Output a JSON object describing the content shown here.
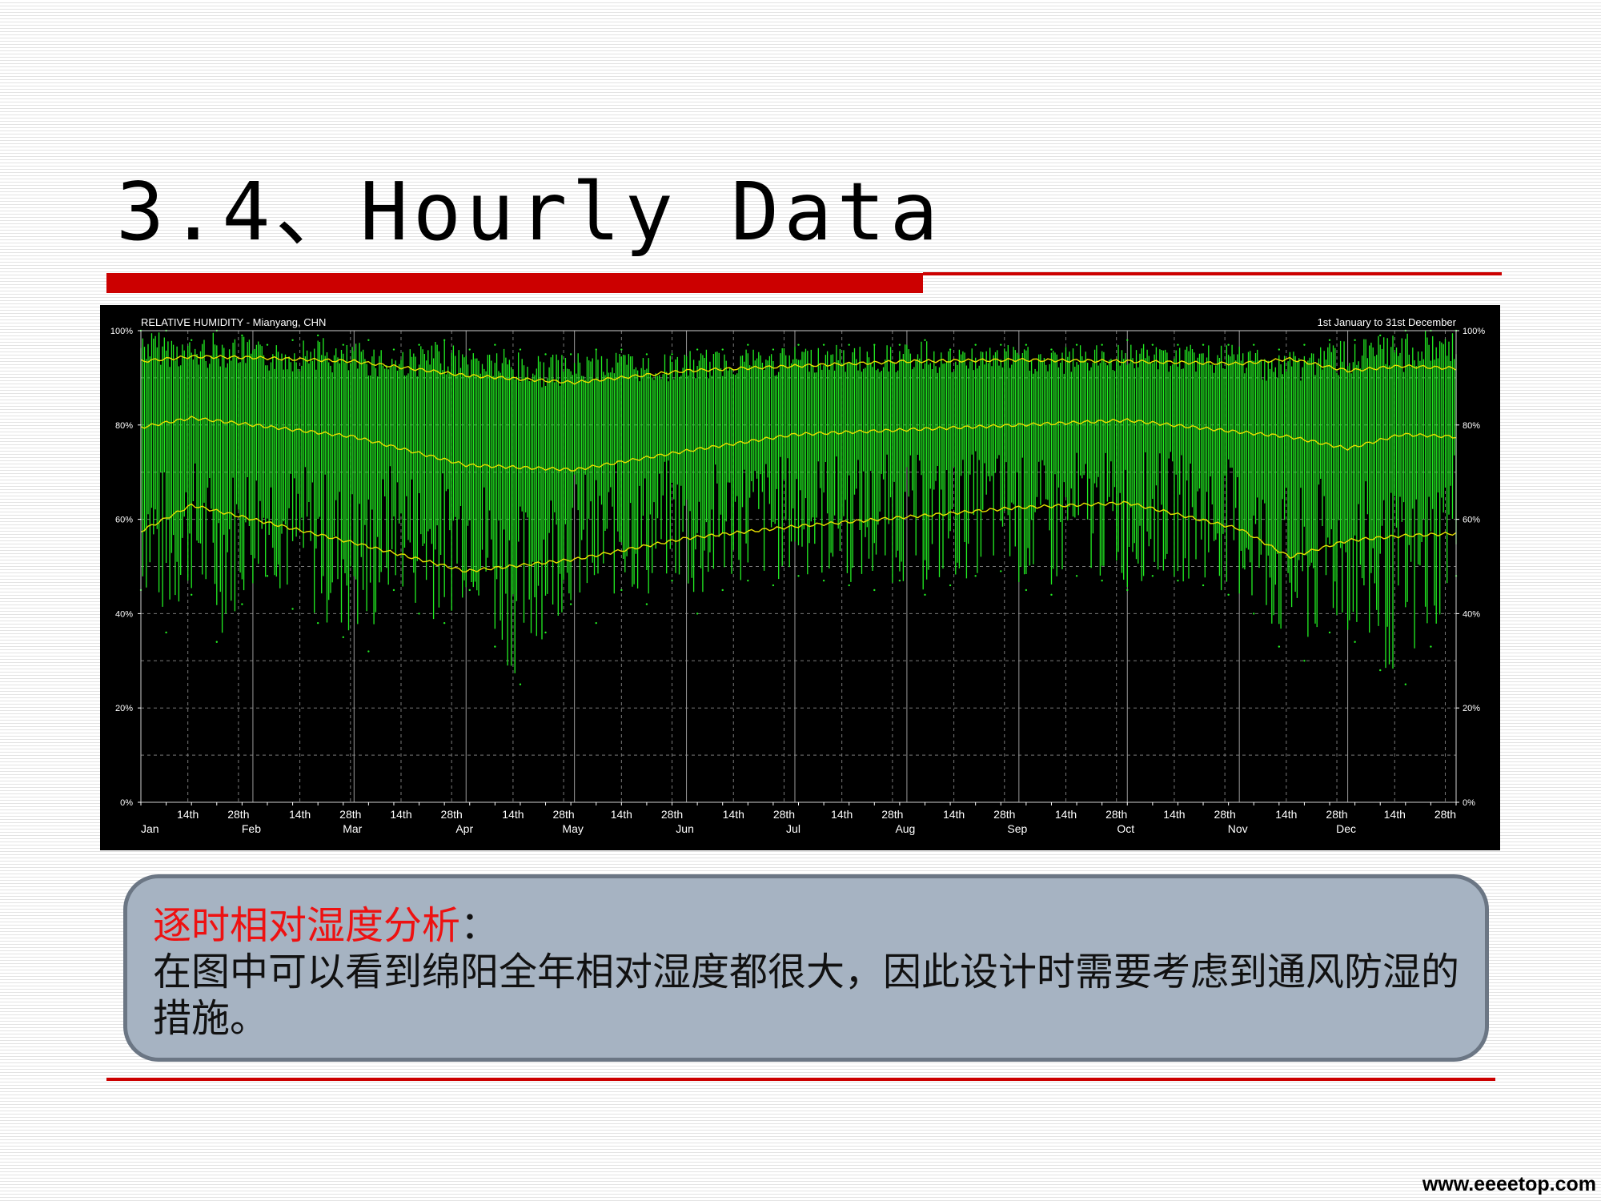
{
  "slide": {
    "title": "3.4、Hourly Data",
    "note_heading": "逐时相对湿度分析",
    "note_colon": "：",
    "note_body": "在图中可以看到绵阳全年相对湿度都很大，因此设计时需要考虑到通风防湿的措施。",
    "watermark": "www.eeeetop.com"
  },
  "colors": {
    "accent_red": "#cc0000",
    "chart_background": "#000000",
    "hourly_series": "#22ee22",
    "statistic_lines": "#e8e000",
    "note_box_fill": "#a6b3c2",
    "note_box_border": "#6b7684",
    "note_heading": "#ee1111"
  },
  "chart_data": {
    "type": "line",
    "title": "RELATIVE HUMIDITY - Mianyang, CHN",
    "period_label": "1st January to 31st December",
    "ylim": [
      0,
      100
    ],
    "y_ticks": [
      0,
      20,
      40,
      60,
      80,
      100
    ],
    "y_tick_labels": [
      "0%",
      "20%",
      "40%",
      "60%",
      "80%",
      "100%"
    ],
    "grid": true,
    "x_unit": "day of year",
    "xlim": [
      1,
      365
    ],
    "months": [
      {
        "label": "Jan",
        "start_day": 1
      },
      {
        "label": "Feb",
        "start_day": 32
      },
      {
        "label": "Mar",
        "start_day": 60
      },
      {
        "label": "Apr",
        "start_day": 91
      },
      {
        "label": "May",
        "start_day": 121
      },
      {
        "label": "Jun",
        "start_day": 152
      },
      {
        "label": "Jul",
        "start_day": 182
      },
      {
        "label": "Aug",
        "start_day": 213
      },
      {
        "label": "Sep",
        "start_day": 244
      },
      {
        "label": "Oct",
        "start_day": 274
      },
      {
        "label": "Nov",
        "start_day": 305
      },
      {
        "label": "Dec",
        "start_day": 335
      }
    ],
    "day_markers": [
      "14th",
      "28th"
    ],
    "series": [
      {
        "role": "hourly relative humidity (daily range)",
        "color": "#22ee22",
        "days": [
          1,
          8,
          15,
          22,
          29,
          36,
          43,
          50,
          57,
          64,
          71,
          78,
          85,
          92,
          99,
          106,
          113,
          120,
          127,
          134,
          141,
          148,
          155,
          162,
          169,
          176,
          183,
          190,
          197,
          204,
          211,
          218,
          225,
          232,
          239,
          246,
          253,
          260,
          267,
          274,
          281,
          288,
          295,
          302,
          309,
          316,
          323,
          330,
          337,
          344,
          351,
          358,
          365
        ],
        "daily_max": [
          100,
          100,
          98,
          100,
          99,
          97,
          98,
          99,
          97,
          98,
          96,
          97,
          98,
          96,
          97,
          96,
          95,
          95,
          96,
          96,
          95,
          95,
          96,
          96,
          97,
          96,
          97,
          97,
          97,
          97,
          97,
          98,
          96,
          97,
          97,
          97,
          96,
          97,
          97,
          98,
          97,
          97,
          97,
          97,
          97,
          96,
          97,
          98,
          98,
          99,
          100,
          100,
          100
        ],
        "daily_min": [
          45,
          36,
          44,
          34,
          42,
          48,
          41,
          38,
          35,
          32,
          45,
          40,
          38,
          45,
          33,
          25,
          36,
          42,
          38,
          45,
          42,
          47,
          40,
          45,
          47,
          46,
          48,
          47,
          46,
          45,
          47,
          44,
          46,
          48,
          49,
          45,
          44,
          48,
          47,
          45,
          48,
          47,
          46,
          44,
          40,
          33,
          30,
          36,
          34,
          28,
          25,
          33,
          48
        ]
      },
      {
        "role": "upper statistic line",
        "color": "#e8e000",
        "days": [
          1,
          15,
          32,
          60,
          91,
          121,
          152,
          182,
          213,
          244,
          274,
          305,
          319,
          335,
          350,
          365
        ],
        "values": [
          93.5,
          94.5,
          94.3,
          93.5,
          90.5,
          89.0,
          91.5,
          92.5,
          93.5,
          93.8,
          93.5,
          93.0,
          94.0,
          91.5,
          92.5,
          92.0
        ]
      },
      {
        "role": "middle statistic line",
        "color": "#e8e000",
        "days": [
          1,
          15,
          32,
          60,
          91,
          121,
          152,
          182,
          213,
          244,
          274,
          305,
          319,
          335,
          350,
          365
        ],
        "values": [
          79.5,
          81.5,
          80.0,
          77.5,
          71.5,
          70.5,
          74.5,
          78.0,
          79.0,
          80.0,
          81.0,
          78.5,
          77.5,
          75.0,
          78.0,
          77.5
        ]
      },
      {
        "role": "lower statistic line",
        "color": "#e8e000",
        "days": [
          1,
          15,
          32,
          60,
          91,
          121,
          152,
          182,
          213,
          244,
          274,
          305,
          319,
          335,
          350,
          365
        ],
        "values": [
          57.5,
          63.0,
          60.0,
          55.0,
          49.0,
          51.5,
          56.0,
          58.5,
          60.5,
          62.5,
          63.5,
          58.0,
          52.0,
          55.5,
          56.5,
          57.0
        ]
      }
    ]
  }
}
